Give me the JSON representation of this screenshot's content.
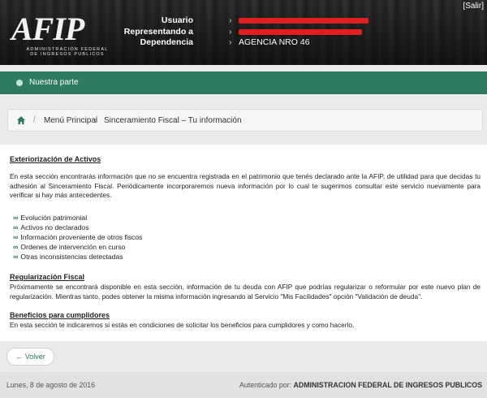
{
  "header": {
    "salir": "[Salir]",
    "logo_mark": "AFIP",
    "logo_line1": "ADMINISTRACION FEDERAL",
    "logo_line2": "DE INGRESOS PUBLICOS",
    "rows": [
      {
        "label": "Usuario",
        "value": ""
      },
      {
        "label": "Representando a",
        "value": ""
      },
      {
        "label": "Dependencia",
        "value": "AGENCIA NRO 46"
      }
    ],
    "redaction_color": "#e02020"
  },
  "greenbar": {
    "label": "Nuestra parte",
    "color": "#2f7a62"
  },
  "breadcrumb": {
    "home_icon": "home-icon",
    "items": [
      "Menú Principal",
      "Sinceramiento Fiscal – Tu información"
    ]
  },
  "content": {
    "s1_title": "Exteriorización de Activos",
    "s1_para": "En esta sección encontrarás información que no se encuentra registrada en el patrimonio que tenés declarado ante la AFIP, de utilidad para que decidas tu adhesión al Sinceramiento Fiscal.   Periódicamente incorporaremos nueva información por lo cual te sugerimos consultar este servicio nuevamente para verificar si hay más antecedentes.",
    "links": [
      "Evolución patrimonial",
      "Activos no declarados",
      "Información proveniente de otros fiscos",
      "Ordenes de intervención en curso",
      "Otras inconsistencias detectadas"
    ],
    "s2_title": "Regularización Fiscal",
    "s2_para": "Próximamente se encontrará disponible en esta sección, información de tu deuda con AFIP que podrías regularizar o reformular por este nuevo plan de regularización. Mientras tanto, podes obtener la misma información ingresando al Servicio \"Mis Facilidades\" opción \"Validación de deuda\".",
    "s3_title": "Beneficios para cumplidores",
    "s3_para": "En esta sección te indicaremos si estás en condiciones de solicitar los beneficios para cumplidores y como hacerlo."
  },
  "volver": "← Volver",
  "footer": {
    "date": "Lunes, 8 de agosto de 2016",
    "auth_prefix": "Autenticado por:",
    "auth_entity": "ADMINISTRACION FEDERAL DE INGRESOS PUBLICOS"
  }
}
